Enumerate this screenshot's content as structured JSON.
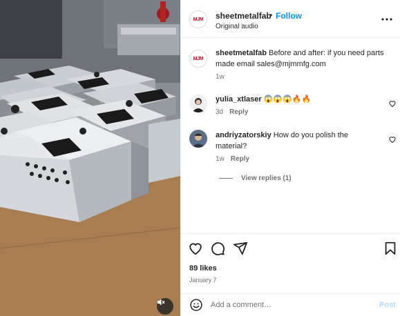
{
  "header": {
    "logo_text": "MJM",
    "username": "sheetmetalfab",
    "separator": "•",
    "follow_label": "Follow",
    "audio_label": "Original audio"
  },
  "caption": {
    "username": "sheetmetalfab",
    "text": "Before and after: if you need parts made email sales@mjmmfg.com",
    "time": "1w"
  },
  "comments": [
    {
      "username": "yulia_xtlaser",
      "text": "😱😱😱🔥🔥",
      "time": "3d",
      "reply_label": "Reply"
    },
    {
      "username": "andriyzatorskiy",
      "text": "How do you polish the material?",
      "time": "1w",
      "reply_label": "Reply",
      "view_replies": "View replies (1)"
    }
  ],
  "actions": {
    "likes": "89 likes",
    "date": "January 7"
  },
  "composer": {
    "placeholder": "Add a comment…",
    "post_label": "Post"
  },
  "icons": {
    "like": "heart-icon",
    "comment": "comment-bubble-icon",
    "share": "paper-plane-icon",
    "save": "bookmark-icon",
    "emoji": "smiley-icon",
    "more": "more-horizontal-icon",
    "mute": "speaker-muted-icon"
  },
  "colors": {
    "accent": "#0095f6",
    "brand_red": "#c8102e",
    "post_disabled": "#b3dbff"
  }
}
